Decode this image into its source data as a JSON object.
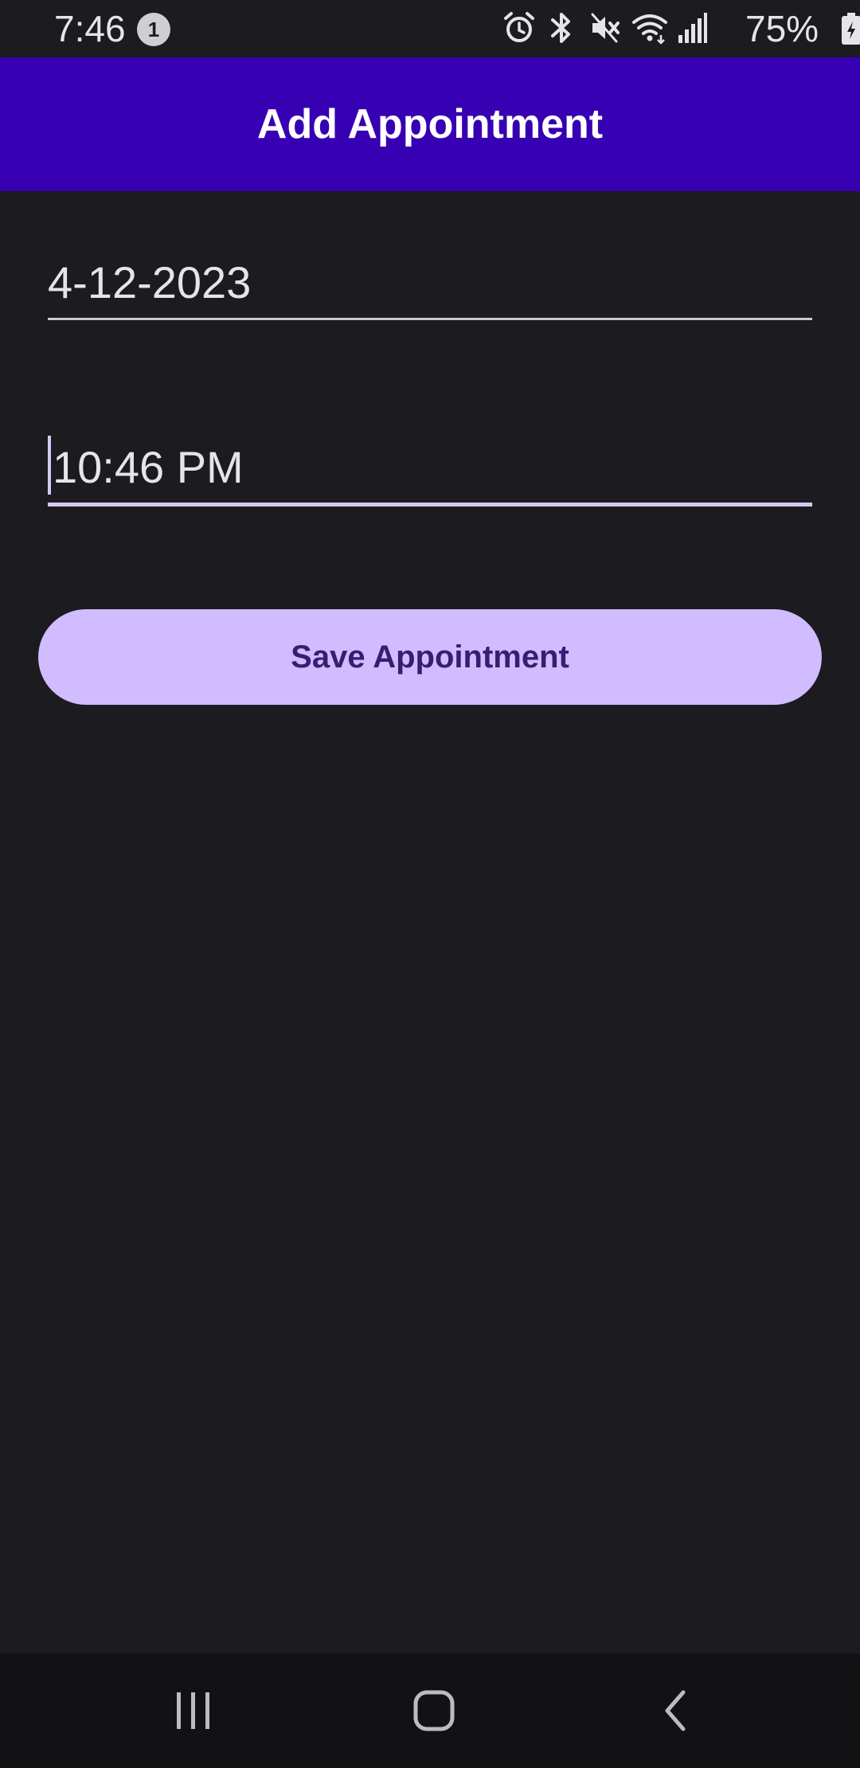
{
  "status_bar": {
    "time": "7:46",
    "notification_count": "1",
    "battery_percent": "75%"
  },
  "app_bar": {
    "title": "Add Appointment"
  },
  "form": {
    "date_value": "4-12-2023",
    "time_value": "10:46 PM",
    "save_label": "Save Appointment"
  },
  "colors": {
    "background": "#1c1b20",
    "app_bar": "#3700b3",
    "button": "#d0bcff",
    "button_text": "#381e72",
    "focus_underline": "#d6c8f5"
  },
  "icons": {
    "status": [
      "alarm-icon",
      "bluetooth-icon",
      "vibrate-mute-icon",
      "wifi-icon",
      "cell-signal-icon",
      "battery-charging-icon"
    ],
    "nav": [
      "recents-icon",
      "home-icon",
      "back-icon"
    ]
  }
}
